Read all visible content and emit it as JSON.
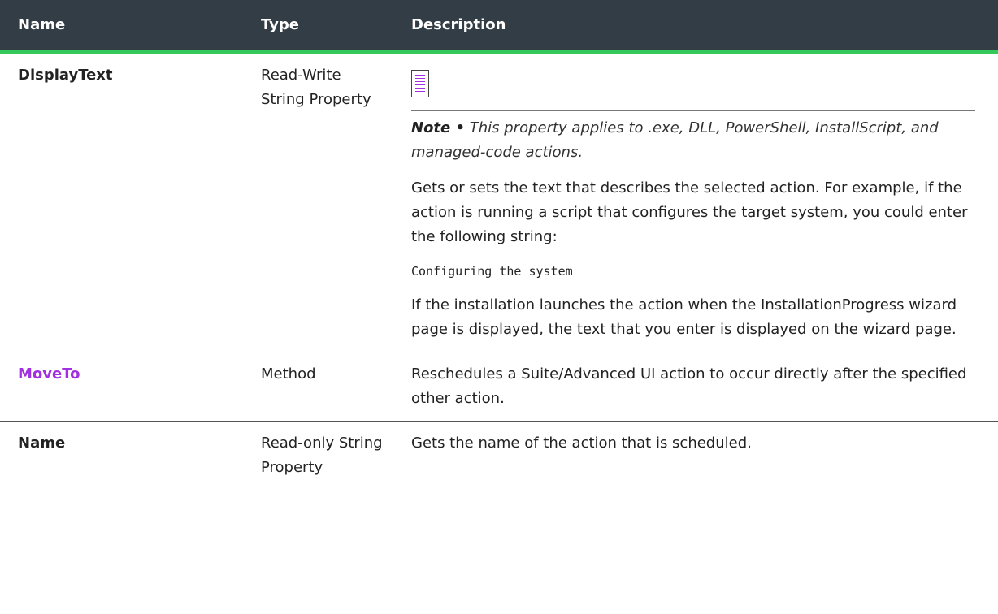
{
  "header": {
    "name": "Name",
    "type": "Type",
    "description": "Description"
  },
  "rows": [
    {
      "name": "DisplayText",
      "type": "Read-Write String Property",
      "note_label": "Note •",
      "note_text": " This property applies to .exe, DLL, PowerShell, InstallScript, and managed-code actions.",
      "para1": "Gets or sets the text that describes the selected action. For example, if the action is running a script that configures the target system, you could enter the following string:",
      "code": "Configuring the system",
      "para2": "If the installation launches the action when the InstallationProgress wizard page is displayed, the text that you enter is displayed on the wizard page."
    },
    {
      "name": "MoveTo",
      "type": "Method",
      "description": "Reschedules a Suite/Advanced UI action to occur directly after the specified other action."
    },
    {
      "name": "Name",
      "type": "Read-only String Property",
      "description": "Gets the name of the action that is scheduled."
    }
  ],
  "icons": {
    "note": "note-icon"
  },
  "colors": {
    "header_bg": "#333d46",
    "header_accent": "#35c95b",
    "link": "#a030e0"
  }
}
